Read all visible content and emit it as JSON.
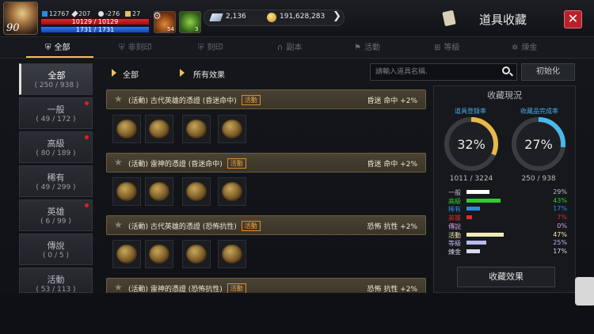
{
  "player": {
    "level": "90",
    "stat_a": "12767",
    "stat_b": "207",
    "stat_c": "-276",
    "stat_d": "27",
    "hp": "10129 / 10129",
    "mp": "1731 / 1731",
    "potion_count": "54",
    "leaf_count": "3"
  },
  "currency": {
    "diamond": "2,136",
    "gold": "191,628,283"
  },
  "header": {
    "title": "道具收藏"
  },
  "tabs": [
    {
      "label": "全部",
      "icon": "shield-icon"
    },
    {
      "label": "非刻印",
      "icon": "shield-off-icon"
    },
    {
      "label": "刻印",
      "icon": "shield-plus-icon"
    },
    {
      "label": "副本",
      "icon": "horseshoe-icon"
    },
    {
      "label": "活動",
      "icon": "flag-icon"
    },
    {
      "label": "等級",
      "icon": "level-icon"
    },
    {
      "label": "煉金",
      "icon": "alchemy-icon"
    }
  ],
  "sidebar": {
    "items": [
      {
        "name": "全部",
        "count": "( 250 / 938 )"
      },
      {
        "name": "一般",
        "count": "( 49 / 172 )"
      },
      {
        "name": "高級",
        "count": "( 80 / 189 )"
      },
      {
        "name": "稀有",
        "count": "( 49 / 299 )"
      },
      {
        "name": "英雄",
        "count": "( 6 / 99 )"
      },
      {
        "name": "傳說",
        "count": "( 0 / 5 )"
      },
      {
        "name": "活動",
        "count": "( 53 / 113 )"
      }
    ]
  },
  "filter": {
    "category": "全部",
    "effect": "所有效果",
    "search_placeholder": "請輸入道具名稱.",
    "reset_label": "初始化"
  },
  "items": [
    {
      "name": "(活動) 古代英雄的憑證 (昏迷命中)",
      "tag": "活動",
      "effect": "昏迷 命中 +2%"
    },
    {
      "name": "(活動) 雷神的憑證 (昏迷命中)",
      "tag": "活動",
      "effect": "昏迷 命中 +2%"
    },
    {
      "name": "(活動) 古代英雄的憑證 (恐怖抗性)",
      "tag": "活動",
      "effect": "恐怖 抗性 +2%"
    },
    {
      "name": "(活動) 雷神的憑證 (恐怖抗性)",
      "tag": "活動",
      "effect": "恐怖 抗性 +2%"
    }
  ],
  "stats": {
    "title": "收藏現況",
    "reg_label": "道具登錄率",
    "reg_percent": "32%",
    "reg_count": "1011 / 3224",
    "reg_fraction": 0.32,
    "comp_label": "收藏品完成率",
    "comp_percent": "27%",
    "comp_count": "250 / 938",
    "comp_fraction": 0.27,
    "legend": [
      {
        "name": "一般",
        "pct": "29%",
        "color": "#ffffff",
        "value": 0.29
      },
      {
        "name": "高級",
        "pct": "43%",
        "color": "#2ad02a",
        "value": 0.43
      },
      {
        "name": "稀有",
        "pct": "17%",
        "color": "#2a8ae0",
        "value": 0.17
      },
      {
        "name": "英雄",
        "pct": "7%",
        "color": "#e02a2a",
        "value": 0.07
      },
      {
        "name": "傳說",
        "pct": "0%",
        "color": "#d0a0e0",
        "value": 0.0
      },
      {
        "name": "活動",
        "pct": "47%",
        "color": "#f0eab8",
        "value": 0.47
      },
      {
        "name": "等級",
        "pct": "25%",
        "color": "#b8b8f0",
        "value": 0.25
      },
      {
        "name": "煉金",
        "pct": "17%",
        "color": "#d8d8ec",
        "value": 0.17
      }
    ],
    "effect_button": "收藏效果"
  },
  "colors": {
    "accent": "#f0c060",
    "ring_left": "#e8b84a",
    "ring_right": "#4ab8e8"
  }
}
